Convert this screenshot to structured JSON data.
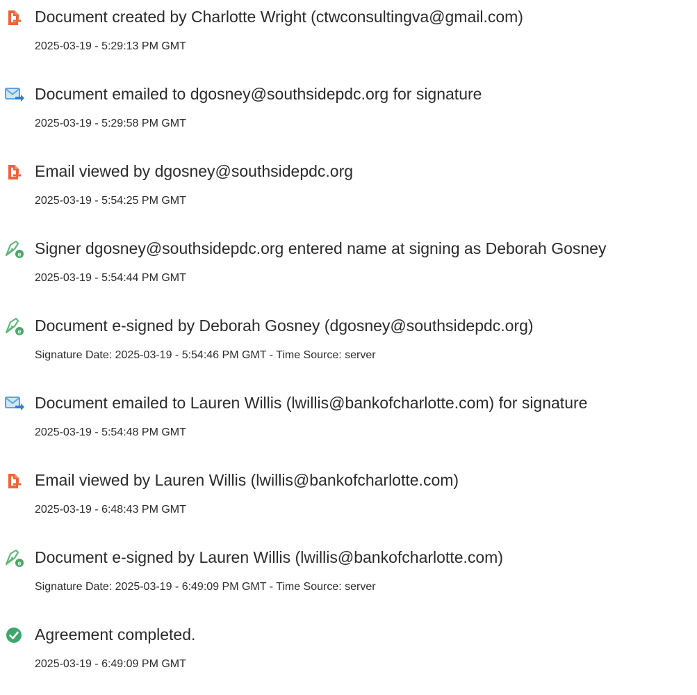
{
  "audit_log": {
    "entries": [
      {
        "icon": "document-created-icon",
        "title": "Document created by Charlotte Wright (ctwconsultingva@gmail.com)",
        "detail": "2025-03-19 - 5:29:13 PM GMT"
      },
      {
        "icon": "email-sent-icon",
        "title": "Document emailed to dgosney@southsidepdc.org for signature",
        "detail": "2025-03-19 - 5:29:58 PM GMT"
      },
      {
        "icon": "document-viewed-icon",
        "title": "Email viewed by dgosney@southsidepdc.org",
        "detail": "2025-03-19 - 5:54:25 PM GMT"
      },
      {
        "icon": "esign-pen-icon",
        "title": "Signer dgosney@southsidepdc.org entered name at signing as Deborah Gosney",
        "detail": "2025-03-19 - 5:54:44 PM GMT"
      },
      {
        "icon": "esign-pen-icon",
        "title": "Document e-signed by Deborah Gosney (dgosney@southsidepdc.org)",
        "detail": "Signature Date: 2025-03-19 - 5:54:46 PM GMT - Time Source: server"
      },
      {
        "icon": "email-sent-icon",
        "title": "Document emailed to Lauren Willis (lwillis@bankofcharlotte.com) for signature",
        "detail": "2025-03-19 - 5:54:48 PM GMT"
      },
      {
        "icon": "document-viewed-icon",
        "title": "Email viewed by Lauren Willis (lwillis@bankofcharlotte.com)",
        "detail": "2025-03-19 - 6:48:43 PM GMT"
      },
      {
        "icon": "esign-pen-icon",
        "title": "Document e-signed by Lauren Willis (lwillis@bankofcharlotte.com)",
        "detail": "Signature Date: 2025-03-19 - 6:49:09 PM GMT - Time Source: server"
      },
      {
        "icon": "completed-check-icon",
        "title": "Agreement completed.",
        "detail": "2025-03-19 - 6:49:09 PM GMT"
      }
    ]
  },
  "colors": {
    "document_icon": "#f0623a",
    "email_icon": "#5aa3dd",
    "pen_icon": "#5fb87a",
    "check_icon": "#3fa66b",
    "text": "#2b2b2b"
  }
}
